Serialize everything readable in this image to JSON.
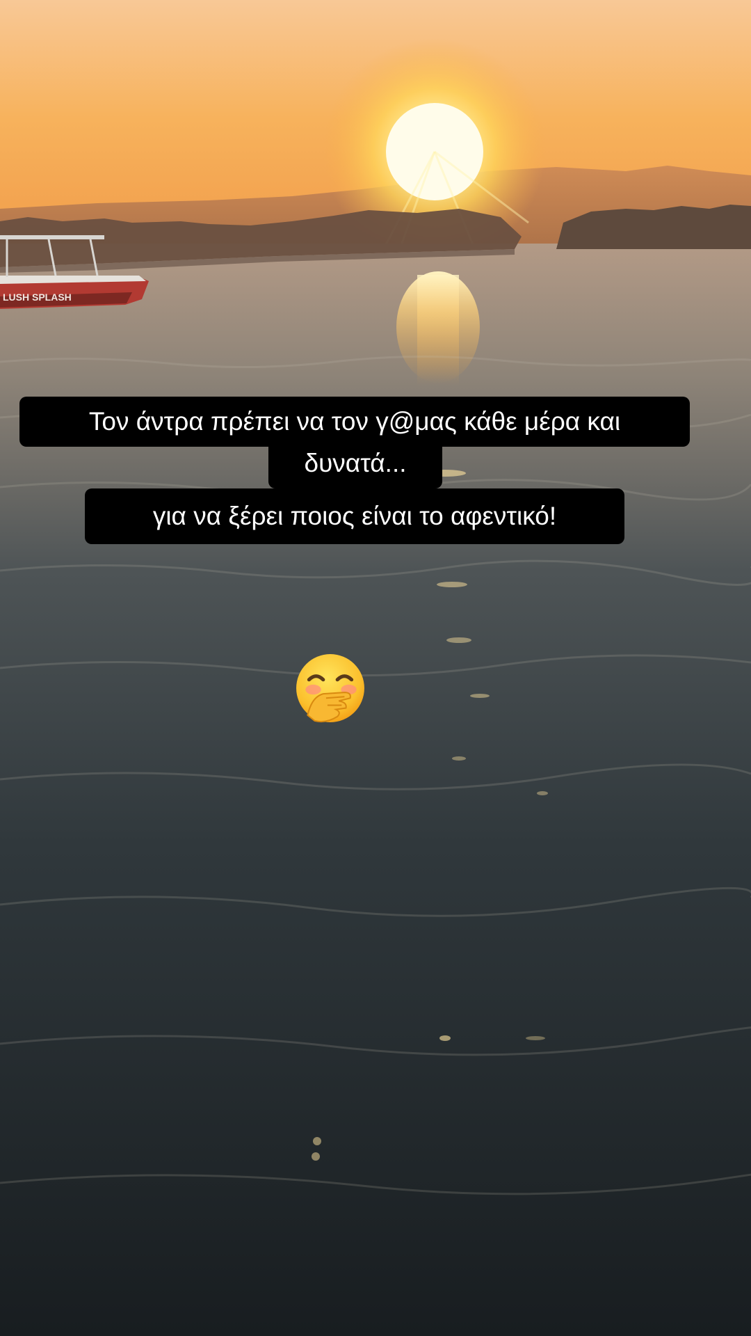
{
  "caption": {
    "line1": "Τον  άντρα πρέπει να τον γ@μας κάθε μέρα και",
    "line2": "δυνατά...",
    "line3": "για να ξέρει ποιος είναι το αφεντικό!"
  },
  "sticker": {
    "icon": "face-with-hand-over-mouth-emoji"
  },
  "photo": {
    "boat_text": "LUSH SPLASH"
  },
  "colors": {
    "caption_bg": "#000000",
    "caption_text": "#ffffff",
    "sky_top": "#f6c48a",
    "sun": "#fff6c0",
    "water_dark": "#1d2428"
  }
}
